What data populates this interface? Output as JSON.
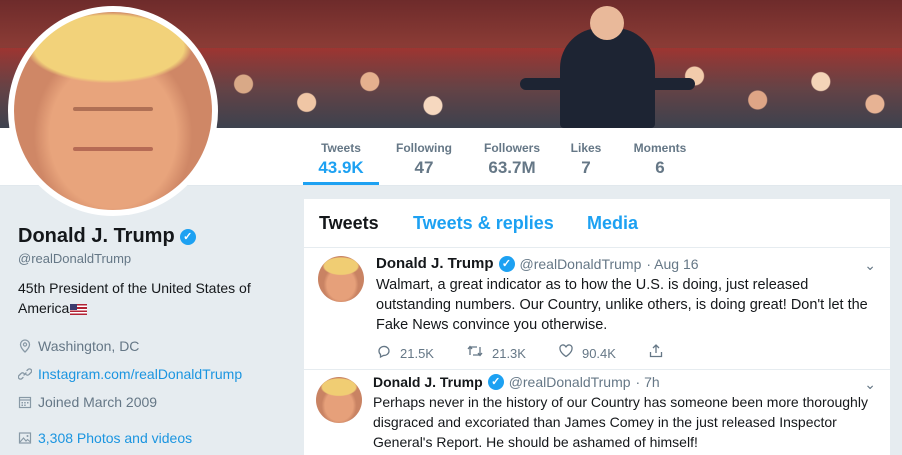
{
  "nav": {
    "stats": [
      {
        "label": "Tweets",
        "value": "43.9K"
      },
      {
        "label": "Following",
        "value": "47"
      },
      {
        "label": "Followers",
        "value": "63.7M"
      },
      {
        "label": "Likes",
        "value": "7"
      },
      {
        "label": "Moments",
        "value": "6"
      }
    ],
    "active_tab": "Tweets"
  },
  "profile": {
    "name": "Donald J. Trump",
    "handle": "@realDonaldTrump",
    "bio": "45th President of the United States of America",
    "location": "Washington, DC",
    "link": "Instagram.com/realDonaldTrump",
    "joined": "Joined March 2009",
    "photos": "3,308 Photos and videos"
  },
  "timeline": {
    "tabs": [
      "Tweets",
      "Tweets & replies",
      "Media"
    ],
    "tweets": [
      {
        "name": "Donald J. Trump",
        "handle": "@realDonaldTrump",
        "time": "· Aug 16",
        "text": "Walmart, a great indicator as to how the U.S. is doing, just released outstanding numbers. Our Country, unlike others, is doing great! Don't let the Fake News convince you otherwise.",
        "replies": "21.5K",
        "retweets": "21.3K",
        "likes": "90.4K"
      },
      {
        "name": "Donald J. Trump",
        "handle": "@realDonaldTrump",
        "time": "· 7h",
        "text": "Perhaps never in the history of our Country has someone been more thoroughly disgraced and excoriated than James Comey in the just released Inspector General's Report. He should be ashamed of himself!"
      }
    ]
  },
  "colors": {
    "accent": "#1da1f2",
    "text": "#14171a",
    "muted": "#657786",
    "background": "#e6ecf0"
  },
  "icons": [
    "verified-badge-icon",
    "location-pin-icon",
    "link-icon",
    "calendar-icon",
    "photo-icon",
    "chevron-down-icon",
    "reply-icon",
    "retweet-icon",
    "like-icon",
    "share-icon"
  ]
}
